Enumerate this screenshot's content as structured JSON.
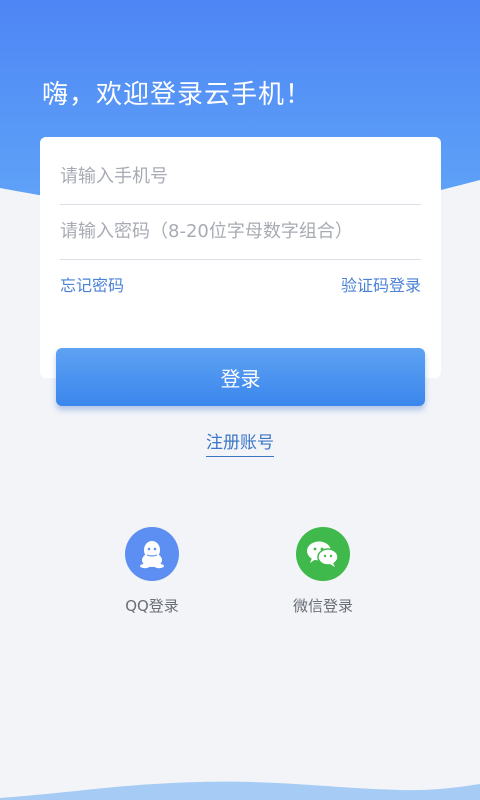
{
  "header": {
    "greeting": "嗨，欢迎登录云手机！"
  },
  "form": {
    "phone_placeholder": "请输入手机号",
    "password_placeholder": "请输入密码（8-20位字母数字组合）",
    "forgot_password": "忘记密码",
    "sms_login": "验证码登录",
    "login_label": "登录",
    "register_label": "注册账号"
  },
  "social": {
    "qq": {
      "label": "QQ登录",
      "icon": "qq-icon"
    },
    "wechat": {
      "label": "微信登录",
      "icon": "wechat-icon"
    }
  },
  "colors": {
    "header_top": "#4e86f5",
    "header_bottom": "#62a8f8",
    "primary": "#4a82d8",
    "qq": "#5d8ff2",
    "wechat": "#3fb94b",
    "background": "#f2f4f8"
  }
}
